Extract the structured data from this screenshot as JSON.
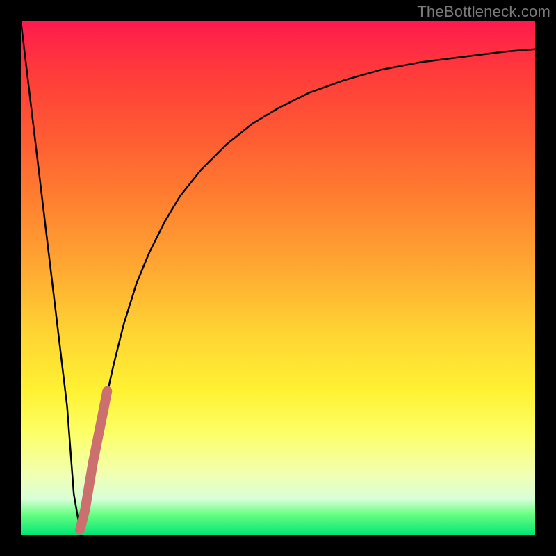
{
  "watermark": "TheBottleneck.com",
  "colors": {
    "curve_stroke": "#000000",
    "highlight_stroke": "#cc6f6f",
    "frame_bg": "#000000",
    "gradient_top": "#ff1a4d",
    "gradient_bottom": "#00e676"
  },
  "chart_data": {
    "type": "line",
    "title": "",
    "xlabel": "",
    "ylabel": "",
    "xlim": [
      0,
      100
    ],
    "ylim": [
      0,
      100
    ],
    "grid": false,
    "series": [
      {
        "name": "bottleneck-curve",
        "x": [
          0,
          3,
          6,
          9,
          10.3,
          11.5,
          12.5,
          14,
          16,
          18,
          20,
          22.5,
          25,
          28,
          31,
          35,
          40,
          45,
          50,
          56,
          63,
          70,
          78,
          86,
          94,
          100
        ],
        "values": [
          100,
          75,
          50,
          25,
          8,
          1,
          5,
          14,
          24,
          33,
          41,
          49,
          55,
          61,
          66,
          71,
          76,
          80,
          83,
          86,
          88.5,
          90.5,
          92,
          93,
          94,
          94.5
        ]
      },
      {
        "name": "highlight-segment",
        "x": [
          11.5,
          12.5,
          14,
          16,
          16.8
        ],
        "values": [
          1,
          5,
          14,
          24,
          28
        ]
      }
    ],
    "annotations": []
  }
}
